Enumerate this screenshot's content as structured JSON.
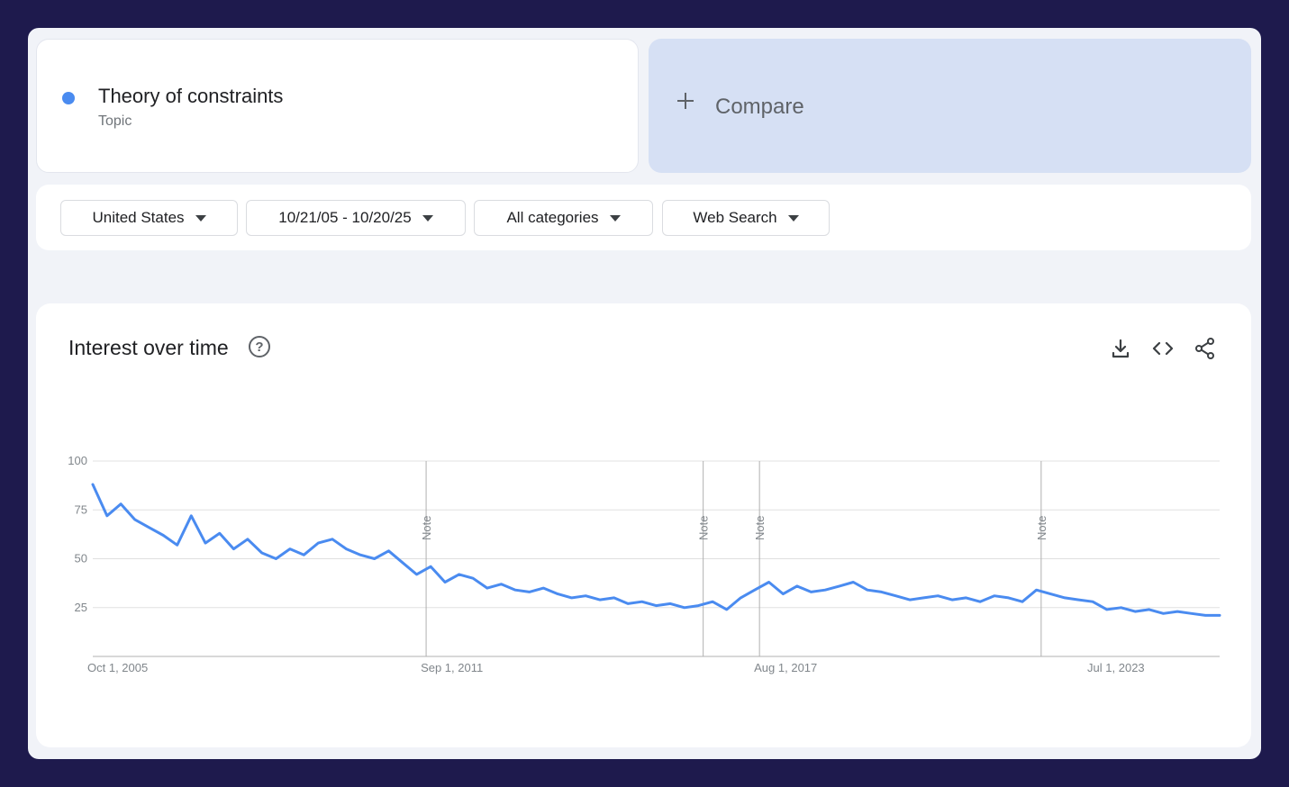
{
  "colors": {
    "series": "#4a8bf0",
    "compare_bg": "#d6e0f4",
    "grid": "#e0e0e0",
    "axis": "#b0b0b0",
    "tick_text": "#80868b"
  },
  "search_term": {
    "name": "Theory of constraints",
    "type": "Topic"
  },
  "compare": {
    "label": "Compare",
    "icon": "plus-icon"
  },
  "filters": [
    {
      "label": "United States",
      "icon": "caret-down-icon"
    },
    {
      "label": "10/21/05 - 10/20/25",
      "icon": "caret-down-icon"
    },
    {
      "label": "All categories",
      "icon": "caret-down-icon"
    },
    {
      "label": "Web Search",
      "icon": "caret-down-icon"
    }
  ],
  "chart_card": {
    "title": "Interest over time",
    "help_icon": "help-circle-icon",
    "toolbar_icons": [
      "download-icon",
      "embed-code-icon",
      "share-icon"
    ]
  },
  "chart_data": {
    "type": "line",
    "x_range": [
      "2005-10-01",
      "2025-10-01"
    ],
    "x_ticks": [
      {
        "label": "Oct 1, 2005",
        "date": "2005-10-01"
      },
      {
        "label": "Sep 1, 2011",
        "date": "2011-09-01"
      },
      {
        "label": "Aug 1, 2017",
        "date": "2017-08-01"
      },
      {
        "label": "Jul 1, 2023",
        "date": "2023-07-01"
      }
    ],
    "ylim": [
      0,
      100
    ],
    "y_ticks": [
      25,
      50,
      75,
      100
    ],
    "grid": true,
    "notes": [
      {
        "label": "Note",
        "date": "2011-09-01"
      },
      {
        "label": "Note",
        "date": "2016-08-01"
      },
      {
        "label": "Note",
        "date": "2017-08-01"
      },
      {
        "label": "Note",
        "date": "2022-08-01"
      }
    ],
    "series": [
      {
        "name": "Theory of constraints",
        "points": [
          [
            "2005-10-01",
            88
          ],
          [
            "2006-01-01",
            72
          ],
          [
            "2006-04-01",
            78
          ],
          [
            "2006-07-01",
            70
          ],
          [
            "2006-10-01",
            66
          ],
          [
            "2007-01-01",
            62
          ],
          [
            "2007-04-01",
            57
          ],
          [
            "2007-07-01",
            72
          ],
          [
            "2007-10-01",
            58
          ],
          [
            "2008-01-01",
            63
          ],
          [
            "2008-04-01",
            55
          ],
          [
            "2008-07-01",
            60
          ],
          [
            "2008-10-01",
            53
          ],
          [
            "2009-01-01",
            50
          ],
          [
            "2009-04-01",
            55
          ],
          [
            "2009-07-01",
            52
          ],
          [
            "2009-10-01",
            58
          ],
          [
            "2010-01-01",
            60
          ],
          [
            "2010-04-01",
            55
          ],
          [
            "2010-07-01",
            52
          ],
          [
            "2010-10-01",
            50
          ],
          [
            "2011-01-01",
            54
          ],
          [
            "2011-04-01",
            48
          ],
          [
            "2011-07-01",
            42
          ],
          [
            "2011-10-01",
            46
          ],
          [
            "2012-01-01",
            38
          ],
          [
            "2012-04-01",
            42
          ],
          [
            "2012-07-01",
            40
          ],
          [
            "2012-10-01",
            35
          ],
          [
            "2013-01-01",
            37
          ],
          [
            "2013-04-01",
            34
          ],
          [
            "2013-07-01",
            33
          ],
          [
            "2013-10-01",
            35
          ],
          [
            "2014-01-01",
            32
          ],
          [
            "2014-04-01",
            30
          ],
          [
            "2014-07-01",
            31
          ],
          [
            "2014-10-01",
            29
          ],
          [
            "2015-01-01",
            30
          ],
          [
            "2015-04-01",
            27
          ],
          [
            "2015-07-01",
            28
          ],
          [
            "2015-10-01",
            26
          ],
          [
            "2016-01-01",
            27
          ],
          [
            "2016-04-01",
            25
          ],
          [
            "2016-07-01",
            26
          ],
          [
            "2016-10-01",
            28
          ],
          [
            "2017-01-01",
            24
          ],
          [
            "2017-04-01",
            30
          ],
          [
            "2017-07-01",
            34
          ],
          [
            "2017-10-01",
            38
          ],
          [
            "2018-01-01",
            32
          ],
          [
            "2018-04-01",
            36
          ],
          [
            "2018-07-01",
            33
          ],
          [
            "2018-10-01",
            34
          ],
          [
            "2019-01-01",
            36
          ],
          [
            "2019-04-01",
            38
          ],
          [
            "2019-07-01",
            34
          ],
          [
            "2019-10-01",
            33
          ],
          [
            "2020-01-01",
            31
          ],
          [
            "2020-04-01",
            29
          ],
          [
            "2020-07-01",
            30
          ],
          [
            "2020-10-01",
            31
          ],
          [
            "2021-01-01",
            29
          ],
          [
            "2021-04-01",
            30
          ],
          [
            "2021-07-01",
            28
          ],
          [
            "2021-10-01",
            31
          ],
          [
            "2022-01-01",
            30
          ],
          [
            "2022-04-01",
            28
          ],
          [
            "2022-07-01",
            34
          ],
          [
            "2022-10-01",
            32
          ],
          [
            "2023-01-01",
            30
          ],
          [
            "2023-04-01",
            29
          ],
          [
            "2023-07-01",
            28
          ],
          [
            "2023-10-01",
            24
          ],
          [
            "2024-01-01",
            25
          ],
          [
            "2024-04-01",
            23
          ],
          [
            "2024-07-01",
            24
          ],
          [
            "2024-10-01",
            22
          ],
          [
            "2025-01-01",
            23
          ],
          [
            "2025-04-01",
            22
          ],
          [
            "2025-07-01",
            21
          ],
          [
            "2025-10-01",
            21
          ]
        ]
      }
    ]
  }
}
